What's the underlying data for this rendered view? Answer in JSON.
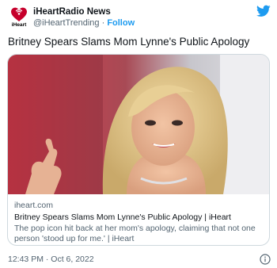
{
  "account": {
    "name": "iHeartRadio News",
    "handle": "@iHeartTrending",
    "separator": "·",
    "follow_label": "Follow",
    "avatar_text": "iHeart",
    "avatar_icon": "iheart-logo-icon",
    "brand_color": "#c6002b"
  },
  "platform": {
    "icon": "twitter-bird-icon",
    "accent_color": "#1d9bf0"
  },
  "tweet": {
    "text": "Britney Spears Slams Mom Lynne's Public Apology",
    "timestamp": "12:43 PM · Oct 6, 2022"
  },
  "card": {
    "image_icon": "article-photo",
    "domain": "iheart.com",
    "title": "Britney Spears Slams Mom Lynne's Public Apology | iHeart",
    "description": "The pop icon hit back at her mom's apology, claiming that not one person 'stood up for me.' | iHeart"
  },
  "footer": {
    "info_icon": "info-icon"
  }
}
